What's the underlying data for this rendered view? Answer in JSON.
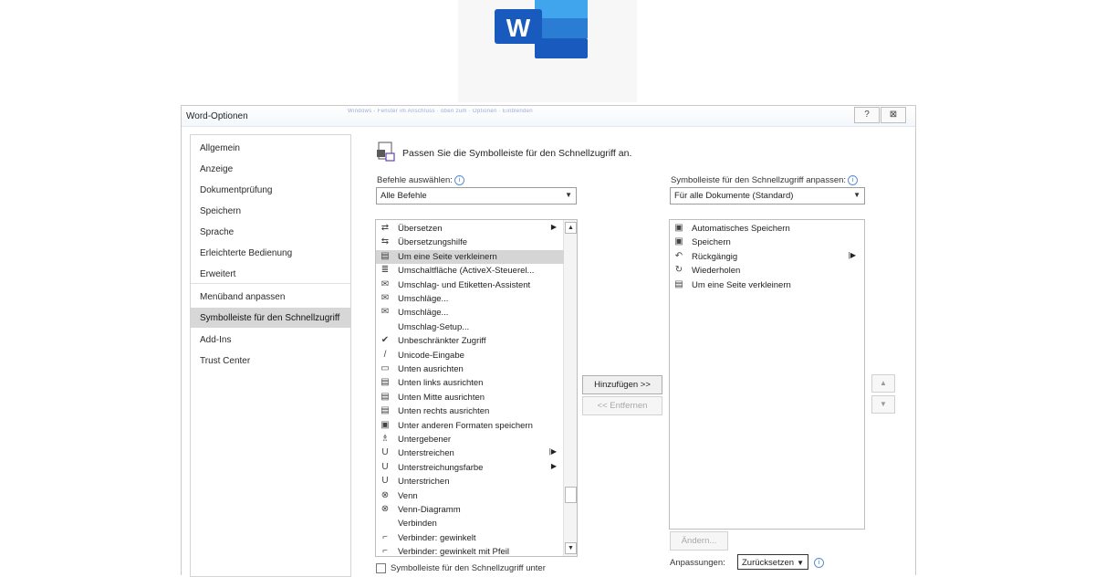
{
  "header": {
    "logo_icon": "word-logo-icon",
    "logo_letter": "W",
    "brand_color": "#185abd"
  },
  "dialog": {
    "title": "Word-Optionen",
    "blurred_caption": "Windows - Fenster im Anschluss · oben zum · Optionen · Einblenden",
    "help_icon": "?",
    "close_icon": "⊠"
  },
  "nav": {
    "items": [
      {
        "label": "Allgemein"
      },
      {
        "label": "Anzeige"
      },
      {
        "label": "Dokumentprüfung"
      },
      {
        "label": "Speichern"
      },
      {
        "label": "Sprache"
      },
      {
        "label": "Erleichterte Bedienung"
      },
      {
        "label": "Erweitert"
      },
      {
        "label": "Menüband anpassen"
      },
      {
        "label": "Symbolleiste für den Schnellzugriff",
        "active": true
      },
      {
        "label": "Add-Ins"
      },
      {
        "label": "Trust Center"
      }
    ]
  },
  "content": {
    "heading": "Passen Sie die Symbolleiste für den Schnellzugriff an.",
    "commands_label": "Befehle auswählen:",
    "commands_value": "Alle Befehle",
    "qat_label": "Symbolleiste für den Schnellzugriff anpassen:",
    "qat_value": "Für alle Dokumente (Standard)",
    "add_button": "Hinzufügen >>",
    "remove_button": "<< Entfernen",
    "modify_button": "Ändern...",
    "adjustments_label": "Anpassungen:",
    "reset_button": "Zurücksetzen",
    "bottom_checkbox": "Symbolleiste für den Schnellzugriff unter"
  },
  "left_list": [
    {
      "icon": "translate-icon",
      "glyph": "⇄",
      "label": "Übersetzen",
      "submenu": true
    },
    {
      "icon": "translation-help-icon",
      "glyph": "⇆",
      "label": "Übersetzungshilfe"
    },
    {
      "icon": "shrink-page-icon",
      "glyph": "▤",
      "label": "Um eine Seite verkleinern",
      "selected": true
    },
    {
      "icon": "activex-toggle-icon",
      "glyph": "≣",
      "label": "Umschaltfläche (ActiveX-Steuerel..."
    },
    {
      "icon": "envelope-icon",
      "glyph": "✉",
      "label": "Umschlag- und Etiketten-Assistent"
    },
    {
      "icon": "envelope-icon",
      "glyph": "✉",
      "label": "Umschläge..."
    },
    {
      "icon": "envelope-icon",
      "glyph": "✉",
      "label": "Umschläge..."
    },
    {
      "icon": "blank-icon",
      "glyph": "",
      "label": "Umschlag-Setup..."
    },
    {
      "icon": "checkmark-icon",
      "glyph": "✔",
      "label": "Unbeschränkter Zugriff"
    },
    {
      "icon": "slash-icon",
      "glyph": "/",
      "label": "Unicode-Eingabe"
    },
    {
      "icon": "align-bottom-icon",
      "glyph": "▭",
      "label": "Unten ausrichten"
    },
    {
      "icon": "align-bottom-left-icon",
      "glyph": "▤",
      "label": "Unten links ausrichten"
    },
    {
      "icon": "align-bottom-center-icon",
      "glyph": "▤",
      "label": "Unten Mitte ausrichten"
    },
    {
      "icon": "align-bottom-right-icon",
      "glyph": "▤",
      "label": "Unten rechts ausrichten"
    },
    {
      "icon": "save-as-icon",
      "glyph": "▣",
      "label": "Unter anderen Formaten speichern"
    },
    {
      "icon": "subordinate-icon",
      "glyph": "♗",
      "label": "Untergebener"
    },
    {
      "icon": "underline-icon",
      "glyph": "U",
      "label": "Unterstreichen",
      "submenu_bar": true
    },
    {
      "icon": "underline-color-icon",
      "glyph": "U",
      "label": "Unterstreichungsfarbe",
      "submenu": true
    },
    {
      "icon": "underline-icon",
      "glyph": "U",
      "label": "Unterstrichen"
    },
    {
      "icon": "venn-icon",
      "glyph": "⊗",
      "label": "Venn"
    },
    {
      "icon": "venn-diagram-icon",
      "glyph": "⊗",
      "label": "Venn-Diagramm"
    },
    {
      "icon": "blank-icon",
      "glyph": "",
      "label": "Verbinden"
    },
    {
      "icon": "elbow-connector-icon",
      "glyph": "⌐",
      "label": "Verbinder: gewinkelt"
    },
    {
      "icon": "elbow-arrow-connector-icon",
      "glyph": "⌐",
      "label": "Verbinder: gewinkelt mit Pfeil"
    }
  ],
  "right_list": [
    {
      "icon": "save-icon",
      "glyph": "▣",
      "label": "Automatisches Speichern"
    },
    {
      "icon": "save-icon",
      "glyph": "▣",
      "label": "Speichern"
    },
    {
      "icon": "undo-icon",
      "glyph": "↶",
      "label": "Rückgängig",
      "submenu_bar": true
    },
    {
      "icon": "redo-icon",
      "glyph": "↻",
      "label": "Wiederholen"
    },
    {
      "icon": "shrink-page-icon",
      "glyph": "▤",
      "label": "Um eine Seite verkleinern"
    }
  ]
}
